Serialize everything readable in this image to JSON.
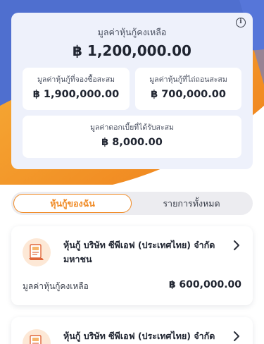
{
  "summary": {
    "remaining_label": "มูลค่าหุ้นกู้คงเหลือ",
    "remaining_value": "฿ 1,200,000.00",
    "purchased_label": "มูลค่าหุ้นกู้ที่จองซื้อสะสม",
    "purchased_value": "฿ 1,900,000.00",
    "redeemed_label": "มูลค่าหุ้นกู้ที่ไถ่ถอนสะสม",
    "redeemed_value": "฿ 700,000.00",
    "interest_label": "มูลค่าดอกเบี้ยที่ได้รับสะสม",
    "interest_value": "฿ 8,000.00",
    "info_icon": "i"
  },
  "tabs": [
    {
      "label": "หุ้นกู้ของฉัน",
      "active": true
    },
    {
      "label": "รายการทั้งหมด",
      "active": false
    }
  ],
  "bonds": [
    {
      "name": "หุ้นกู้ บริษัท ซีพีเอฟ (ประเทศไทย) จำกัด มหาชน",
      "remaining_label": "มูลค่าหุ้นกู้คงเหลือ",
      "remaining_value": "฿ 600,000.00"
    },
    {
      "name": "หุ้นกู้ บริษัท ซีพีเอฟ (ประเทศไทย) จำกัด มหาชน"
    }
  ],
  "colors": {
    "accent": "#f08a24",
    "hero_blue": "#4f6fcf",
    "hero_orange": "#f5a623",
    "card_bg": "#eef1fb"
  },
  "icons": [
    "info-icon",
    "bond-certificate-icon",
    "chevron-right-icon"
  ]
}
